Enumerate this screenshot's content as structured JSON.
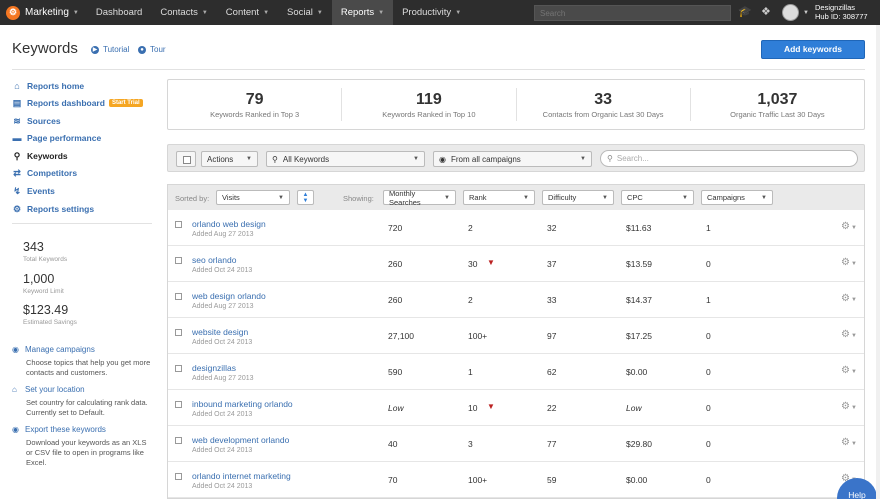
{
  "nav": {
    "brand": "Marketing",
    "brand_icon": "sprocket-icon",
    "items": [
      {
        "label": "Dashboard",
        "caret": false,
        "active": false
      },
      {
        "label": "Contacts",
        "caret": true,
        "active": false
      },
      {
        "label": "Content",
        "caret": true,
        "active": false
      },
      {
        "label": "Social",
        "caret": true,
        "active": false
      },
      {
        "label": "Reports",
        "caret": true,
        "active": true
      },
      {
        "label": "Productivity",
        "caret": true,
        "active": false
      }
    ],
    "search_placeholder": "Search",
    "account_name": "Designzillas",
    "hub_id": "Hub ID: 308777"
  },
  "header": {
    "title": "Keywords",
    "tutorial": "Tutorial",
    "tour": "Tour",
    "add_button": "Add keywords",
    "accent": "#2f7ed8"
  },
  "sidebar": {
    "items": [
      {
        "label": "Reports home",
        "icon": "home-icon",
        "current": false
      },
      {
        "label": "Reports dashboard",
        "icon": "bar-chart-icon",
        "current": false,
        "badge": "Start Trial"
      },
      {
        "label": "Sources",
        "icon": "sources-icon",
        "current": false
      },
      {
        "label": "Page performance",
        "icon": "page-icon",
        "current": false
      },
      {
        "label": "Keywords",
        "icon": "key-icon",
        "current": true
      },
      {
        "label": "Competitors",
        "icon": "arrows-icon",
        "current": false
      },
      {
        "label": "Events",
        "icon": "lightning-icon",
        "current": false
      },
      {
        "label": "Reports settings",
        "icon": "gear-icon",
        "current": false
      }
    ],
    "stats": [
      {
        "value": "343",
        "label": "Total Keywords"
      },
      {
        "value": "1,000",
        "label": "Keyword Limit"
      },
      {
        "value": "$123.49",
        "label": "Estimated Savings"
      }
    ],
    "help": [
      {
        "title": "Manage campaigns",
        "icon": "globe-icon",
        "text": "Choose topics that help you get more contacts and customers."
      },
      {
        "title": "Set your location",
        "icon": "home-icon",
        "text": "Set country for calculating rank data. Currently set to Default."
      },
      {
        "title": "Export these keywords",
        "icon": "globe-icon",
        "text": "Download your keywords as an XLS or CSV file to open in programs like Excel."
      }
    ]
  },
  "stats_panel": [
    {
      "value": "79",
      "label": "Keywords Ranked in Top 3"
    },
    {
      "value": "119",
      "label": "Keywords Ranked in Top 10"
    },
    {
      "value": "33",
      "label": "Contacts from Organic Last 30 Days"
    },
    {
      "value": "1,037",
      "label": "Organic Traffic Last 30 Days"
    }
  ],
  "toolbar": {
    "actions": "Actions",
    "keyword_filter": "All Keywords",
    "campaign_filter": "From all campaigns",
    "search_placeholder": "Search..."
  },
  "filters": {
    "sorted_by_label": "Sorted by:",
    "sorted_by_value": "Visits",
    "showing_label": "Showing:",
    "columns": [
      "Monthly Searches",
      "Rank",
      "Difficulty",
      "CPC",
      "Campaigns"
    ]
  },
  "rows": [
    {
      "keyword": "orlando web design",
      "added": "Added Aug 27 2013",
      "searches": "720",
      "rank": "2",
      "down": false,
      "difficulty": "32",
      "cpc": "$11.63",
      "campaigns": "1"
    },
    {
      "keyword": "seo orlando",
      "added": "Added Oct 24 2013",
      "searches": "260",
      "rank": "30",
      "down": true,
      "difficulty": "37",
      "cpc": "$13.59",
      "campaigns": "0"
    },
    {
      "keyword": "web design orlando",
      "added": "Added Aug 27 2013",
      "searches": "260",
      "rank": "2",
      "down": false,
      "difficulty": "33",
      "cpc": "$14.37",
      "campaigns": "1"
    },
    {
      "keyword": "website design",
      "added": "Added Oct 24 2013",
      "searches": "27,100",
      "rank": "100+",
      "down": false,
      "difficulty": "97",
      "cpc": "$17.25",
      "campaigns": "0"
    },
    {
      "keyword": "designzillas",
      "added": "Added Aug 27 2013",
      "searches": "590",
      "rank": "1",
      "down": false,
      "difficulty": "62",
      "cpc": "$0.00",
      "campaigns": "0"
    },
    {
      "keyword": "inbound marketing orlando",
      "added": "Added Oct 24 2013",
      "searches": "Low",
      "rank": "10",
      "down": true,
      "difficulty": "22",
      "cpc": "Low",
      "campaigns": "0"
    },
    {
      "keyword": "web development orlando",
      "added": "Added Oct 24 2013",
      "searches": "40",
      "rank": "3",
      "down": false,
      "difficulty": "77",
      "cpc": "$29.80",
      "campaigns": "0"
    },
    {
      "keyword": "orlando internet marketing",
      "added": "Added Oct 24 2013",
      "searches": "70",
      "rank": "100+",
      "down": false,
      "difficulty": "59",
      "cpc": "$0.00",
      "campaigns": "0"
    }
  ],
  "help_button": "Help"
}
